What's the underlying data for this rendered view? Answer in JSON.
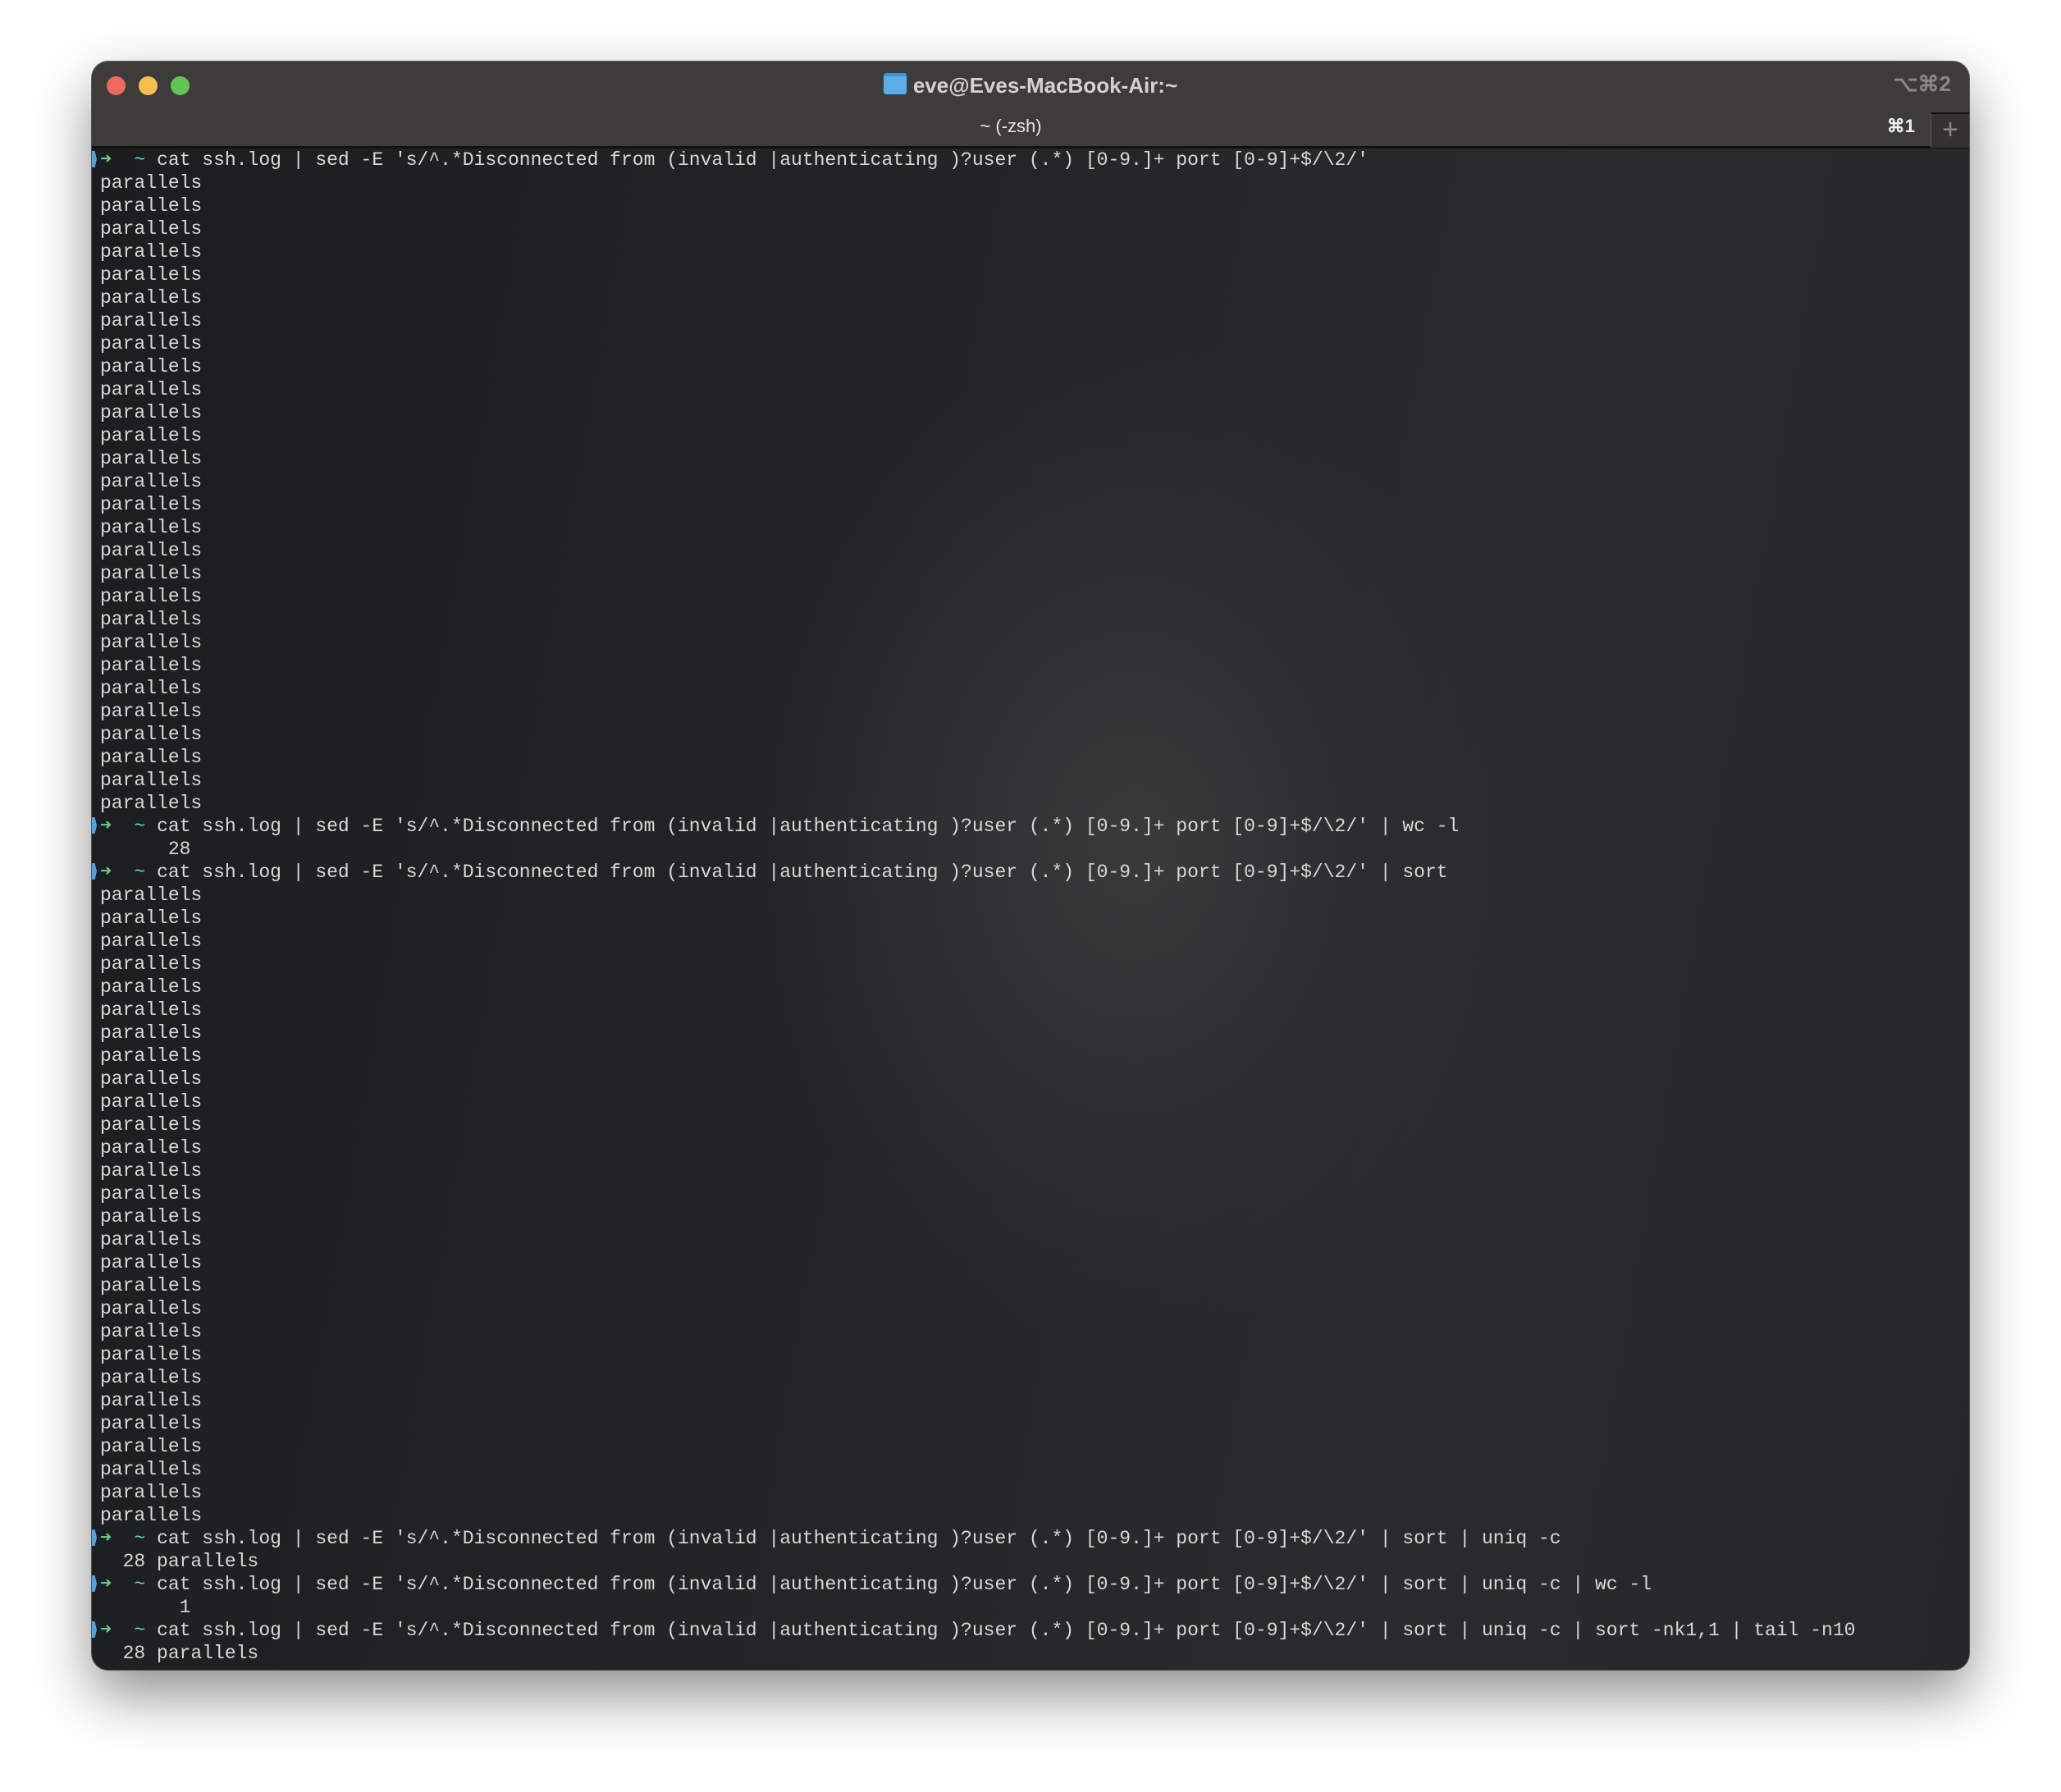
{
  "window": {
    "title": "eve@Eves-MacBook-Air:~",
    "window_shortcut": "⌥⌘2",
    "tab": {
      "label": "~ (-zsh)",
      "shortcut": "⌘1"
    },
    "new_tab": "+",
    "colors": {
      "close": "#ed6a5e",
      "minimize": "#f5bf4f",
      "zoom": "#61c554"
    }
  },
  "prompt": {
    "arrow": "➜",
    "cwd": "~"
  },
  "session": [
    {
      "command": "cat ssh.log | sed -E 's/^.*Disconnected from (invalid |authenticating )?user (.*) [0-9.]+ port [0-9]+$/\\2/'",
      "output": [
        "parallels",
        "parallels",
        "parallels",
        "parallels",
        "parallels",
        "parallels",
        "parallels",
        "parallels",
        "parallels",
        "parallels",
        "parallels",
        "parallels",
        "parallels",
        "parallels",
        "parallels",
        "parallels",
        "parallels",
        "parallels",
        "parallels",
        "parallels",
        "parallels",
        "parallels",
        "parallels",
        "parallels",
        "parallels",
        "parallels",
        "parallels",
        "parallels"
      ]
    },
    {
      "command": "cat ssh.log | sed -E 's/^.*Disconnected from (invalid |authenticating )?user (.*) [0-9.]+ port [0-9]+$/\\2/' | wc -l",
      "output": [
        "      28"
      ]
    },
    {
      "command": "cat ssh.log | sed -E 's/^.*Disconnected from (invalid |authenticating )?user (.*) [0-9.]+ port [0-9]+$/\\2/' | sort",
      "output": [
        "parallels",
        "parallels",
        "parallels",
        "parallels",
        "parallels",
        "parallels",
        "parallels",
        "parallels",
        "parallels",
        "parallels",
        "parallels",
        "parallels",
        "parallels",
        "parallels",
        "parallels",
        "parallels",
        "parallels",
        "parallels",
        "parallels",
        "parallels",
        "parallels",
        "parallels",
        "parallels",
        "parallels",
        "parallels",
        "parallels",
        "parallels",
        "parallels"
      ]
    },
    {
      "command": "cat ssh.log | sed -E 's/^.*Disconnected from (invalid |authenticating )?user (.*) [0-9.]+ port [0-9]+$/\\2/' | sort | uniq -c",
      "output": [
        "  28 parallels"
      ]
    },
    {
      "command": "cat ssh.log | sed -E 's/^.*Disconnected from (invalid |authenticating )?user (.*) [0-9.]+ port [0-9]+$/\\2/' | sort | uniq -c | wc -l",
      "output": [
        "       1"
      ]
    },
    {
      "command": "cat ssh.log | sed -E 's/^.*Disconnected from (invalid |authenticating )?user (.*) [0-9.]+ port [0-9]+$/\\2/' | sort | uniq -c | sort -nk1,1 | tail -n10",
      "output": [
        "  28 parallels"
      ]
    }
  ]
}
